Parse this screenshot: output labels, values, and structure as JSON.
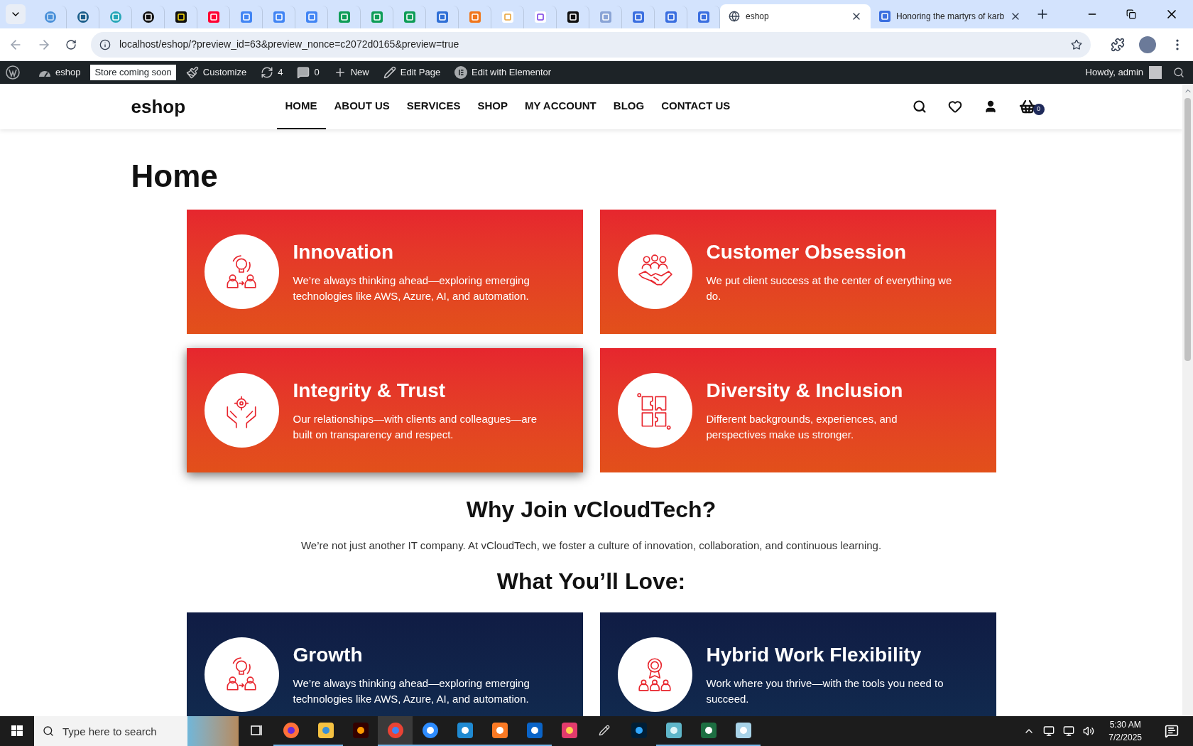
{
  "browser": {
    "favicon_tabs": [
      {
        "kind": "circle",
        "selected": false
      },
      {
        "kind": "ring",
        "selected": false
      },
      {
        "kind": "hex",
        "selected": false
      },
      {
        "kind": "knot",
        "selected": false
      },
      {
        "kind": "bolt",
        "selected": false
      },
      {
        "kind": "video",
        "selected": false
      },
      {
        "kind": "doc",
        "selected": false
      },
      {
        "kind": "doc",
        "selected": false
      },
      {
        "kind": "doc",
        "selected": false
      },
      {
        "kind": "sheet",
        "selected": false
      },
      {
        "kind": "sheet",
        "selected": false
      },
      {
        "kind": "sheet",
        "selected": false
      },
      {
        "kind": "chart",
        "selected": false
      },
      {
        "kind": "box",
        "selected": false
      },
      {
        "kind": "bird",
        "selected": false
      },
      {
        "kind": "code",
        "selected": false
      },
      {
        "kind": "dark",
        "selected": false
      },
      {
        "kind": "grid",
        "selected": false
      },
      {
        "kind": "form",
        "selected": false
      },
      {
        "kind": "form",
        "selected": false
      },
      {
        "kind": "form",
        "selected": false
      }
    ],
    "tabs": [
      {
        "title": "eshop",
        "kind": "globe",
        "selected": true
      },
      {
        "title": "Honoring the martyrs of karb",
        "kind": "form",
        "selected": false
      }
    ],
    "url": "localhost/eshop/?preview_id=63&preview_nonce=c2072d0165&preview=true"
  },
  "admin_bar": {
    "items": [
      {
        "kind": "site",
        "label": "eshop"
      },
      {
        "kind": "badge",
        "label": "Store coming soon"
      },
      {
        "kind": "brush",
        "label": "Customize"
      },
      {
        "kind": "updates",
        "label": "4"
      },
      {
        "kind": "comments",
        "label": "0"
      },
      {
        "kind": "plus",
        "label": "New"
      },
      {
        "kind": "pencil",
        "label": "Edit Page"
      },
      {
        "kind": "elementor",
        "label": "Edit with Elementor"
      }
    ],
    "greeting": "Howdy, admin"
  },
  "site_header": {
    "logo": "eshop",
    "nav": [
      {
        "label": "HOME",
        "selected": true
      },
      {
        "label": "ABOUT US",
        "selected": false
      },
      {
        "label": "SERVICES",
        "selected": false
      },
      {
        "label": "SHOP",
        "selected": false
      },
      {
        "label": "MY ACCOUNT",
        "selected": false
      },
      {
        "label": "BLOG",
        "selected": false
      },
      {
        "label": "CONTACT US",
        "selected": false
      }
    ],
    "cart_count": "0"
  },
  "page_title": "Home",
  "values": [
    {
      "title": "Innovation",
      "text": "We’re always thinking ahead—exploring emerging technologies like AWS, Azure, AI, and automation.",
      "kind": "bulb",
      "highlighted": false
    },
    {
      "title": "Customer Obsession",
      "text": "We put client success at the center of everything we do.",
      "kind": "handshake",
      "highlighted": false
    },
    {
      "title": "Integrity & Trust",
      "text": "Our relationships—with clients and colleagues—are built on transparency and respect.",
      "kind": "hands",
      "highlighted": true
    },
    {
      "title": "Diversity & Inclusion",
      "text": "Different backgrounds, experiences, and perspectives make us stronger.",
      "kind": "puzzle",
      "highlighted": false
    }
  ],
  "why_join": {
    "heading": "Why Join vCloudTech?",
    "text": "We’re not just another IT company. At vCloudTech, we foster a culture of innovation, collaboration, and continuous learning."
  },
  "love": {
    "heading": "What You’ll Love:",
    "cards": [
      {
        "title": "Growth",
        "text": "We’re always thinking ahead—exploring emerging technologies like AWS, Azure, AI, and automation.",
        "kind": "bulb"
      },
      {
        "title": "Hybrid Work Flexibility",
        "text": "Work where you thrive—with the tools you need to succeed.",
        "kind": "medal"
      }
    ]
  },
  "taskbar": {
    "search_placeholder": "Type here to search",
    "apps": [
      {
        "kind": "taskview",
        "running": false,
        "selected": false
      },
      {
        "kind": "firefox",
        "running": true,
        "selected": false
      },
      {
        "kind": "folder",
        "running": true,
        "selected": false
      },
      {
        "kind": "illustrator",
        "running": false,
        "selected": false
      },
      {
        "kind": "chrome",
        "running": true,
        "selected": true
      },
      {
        "kind": "zoom",
        "running": true,
        "selected": false
      },
      {
        "kind": "vscode",
        "running": true,
        "selected": false
      },
      {
        "kind": "xampp",
        "running": true,
        "selected": false
      },
      {
        "kind": "outlook",
        "running": true,
        "selected": false
      },
      {
        "kind": "cloud",
        "running": false,
        "selected": false
      },
      {
        "kind": "pen",
        "running": false,
        "selected": false
      },
      {
        "kind": "photoshop",
        "running": false,
        "selected": false
      },
      {
        "kind": "gem",
        "running": true,
        "selected": false
      },
      {
        "kind": "excel",
        "running": true,
        "selected": false
      },
      {
        "kind": "notepad",
        "running": true,
        "selected": false
      }
    ],
    "time": "5:30 AM",
    "date": "7/2/2025"
  }
}
